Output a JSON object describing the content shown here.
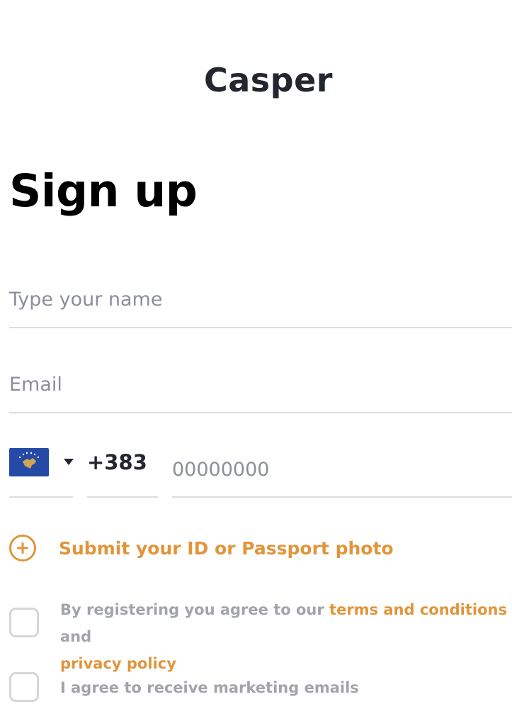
{
  "header": {
    "brand": "Casper"
  },
  "form": {
    "title": "Sign up",
    "name_placeholder": "Type your name",
    "email_placeholder": "Email",
    "phone": {
      "country_flag_icon": "kosovo-flag-icon",
      "dial_code": "+383",
      "number_placeholder": "00000000"
    },
    "upload": {
      "icon": "plus-circle-icon",
      "label": "Submit your ID or Passport photo"
    },
    "terms": {
      "text_before": "By registering you agree to our ",
      "terms_link": "terms and conditions",
      "text_middle": " and ",
      "privacy_link": "privacy policy",
      "checked": false
    },
    "marketing": {
      "label": "I agree to receive marketing emails",
      "checked": false
    }
  },
  "colors": {
    "accent": "#e0953b",
    "text_dark": "#23252f",
    "muted": "#a2a4ab",
    "divider": "#dcdde0",
    "flag_blue": "#244aa5",
    "flag_gold": "#d0a650"
  }
}
